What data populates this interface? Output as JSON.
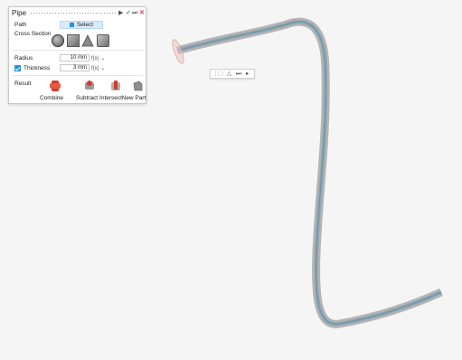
{
  "panel": {
    "title": "Pipe",
    "path_label": "Path",
    "select_label": "Select",
    "cross_section_label": "Cross Section",
    "radius_label": "Radius",
    "radius_value": "10 mm",
    "thickness_label": "Thickness",
    "thickness_value": "3 mm",
    "thickness_checked": true,
    "fx_label": "f(x)",
    "result_label": "Result",
    "result_options": [
      "Combine",
      "Subtract",
      "Intersect",
      "New Part"
    ],
    "selected_result": "Combine"
  },
  "colors": {
    "accent": "#1e8fd6",
    "close": "#e0393e",
    "ok": "#3aa84a",
    "pipe_outer": "#b9b4b4",
    "pipe_inner": "#7fa2b2"
  }
}
